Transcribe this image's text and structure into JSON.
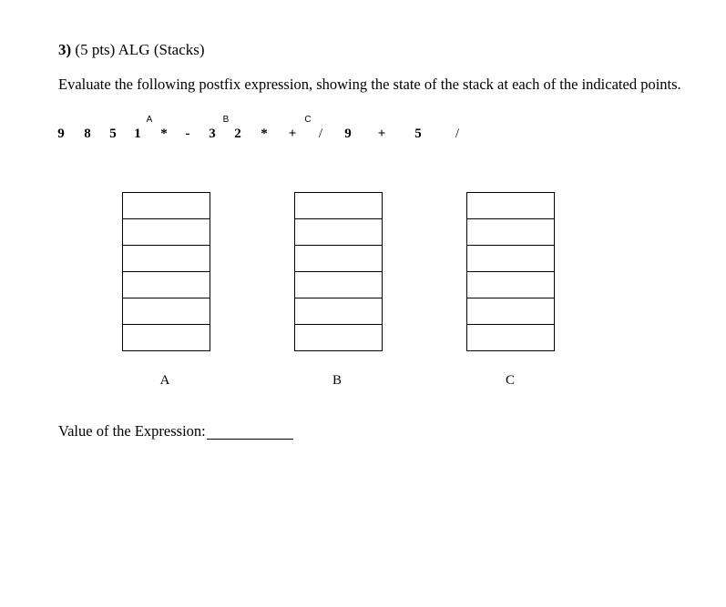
{
  "question": {
    "number": "3)",
    "detail": "(5 pts) ALG (Stacks)"
  },
  "instructions": "Evaluate the following postfix expression, showing the state of the stack at each of the indicated points.",
  "expression": {
    "tokens": [
      "9",
      "8",
      "5",
      "1",
      "*",
      "-",
      "3",
      "2",
      "*",
      "+",
      "/",
      "9",
      "+",
      "5",
      "/"
    ],
    "markers": [
      "A",
      "B",
      "C"
    ]
  },
  "stacks": [
    {
      "label": "A",
      "rows": 6
    },
    {
      "label": "B",
      "rows": 6
    },
    {
      "label": "C",
      "rows": 6
    }
  ],
  "value_label": "Value of the Expression:"
}
